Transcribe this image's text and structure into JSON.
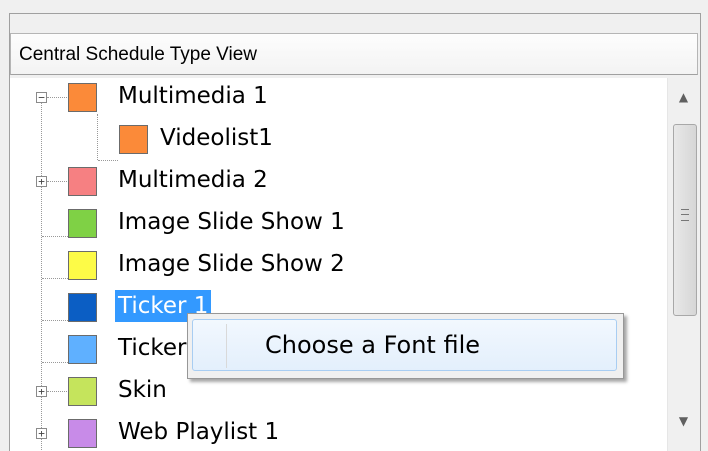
{
  "header": {
    "title": "Central Schedule Type View"
  },
  "tree": {
    "items": [
      {
        "label": "Multimedia 1",
        "color": "#fb8a39",
        "expander": "−"
      },
      {
        "label": "Videolist1",
        "color": "#fb8a39",
        "expander": ""
      },
      {
        "label": "Multimedia 2",
        "color": "#f68082",
        "expander": "+"
      },
      {
        "label": "Image Slide Show 1",
        "color": "#7fd145",
        "expander": ""
      },
      {
        "label": "Image Slide Show 2",
        "color": "#fdfb47",
        "expander": ""
      },
      {
        "label": "Ticker 1",
        "color": "#0b5ec4",
        "expander": ""
      },
      {
        "label": "Ticker",
        "color": "#5fb0ff",
        "expander": ""
      },
      {
        "label": "Skin",
        "color": "#c5e45c",
        "expander": "+"
      },
      {
        "label": "Web Playlist 1",
        "color": "#c88be8",
        "expander": "+"
      }
    ]
  },
  "context_menu": {
    "items": [
      {
        "label": "Choose a Font file"
      }
    ]
  },
  "scrollbar": {
    "up_glyph": "▲",
    "down_glyph": "▼"
  }
}
